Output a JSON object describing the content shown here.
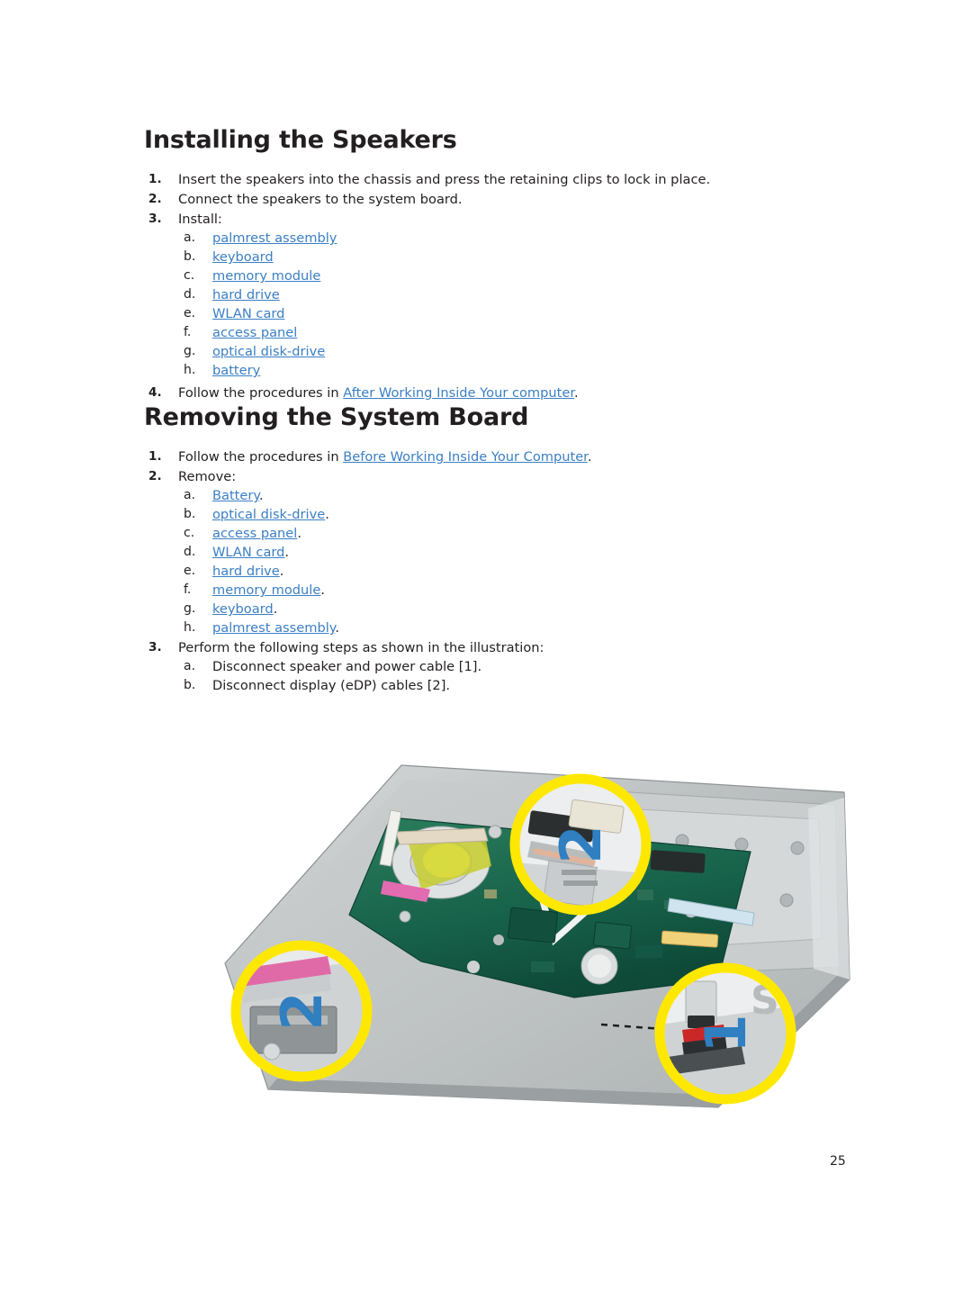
{
  "document": {
    "page_number": "25",
    "sections": [
      {
        "id": "installing-speakers",
        "title": "Installing the Speakers",
        "steps": [
          {
            "num": "1.",
            "text": "Insert the speakers into the chassis and press the retaining clips to lock in place."
          },
          {
            "num": "2.",
            "text": "Connect the speakers to the system board."
          },
          {
            "num": "3.",
            "text": "Install:",
            "sub": [
              {
                "num": "a.",
                "link": "palmrest assembly",
                "tail": ""
              },
              {
                "num": "b.",
                "link": "keyboard",
                "tail": ""
              },
              {
                "num": "c.",
                "link": "memory module",
                "tail": ""
              },
              {
                "num": "d.",
                "link": "hard drive",
                "tail": ""
              },
              {
                "num": "e.",
                "link": "WLAN card",
                "tail": ""
              },
              {
                "num": "f.",
                "link": "access panel",
                "tail": ""
              },
              {
                "num": "g.",
                "link": "optical disk-drive",
                "tail": ""
              },
              {
                "num": "h.",
                "link": "battery",
                "tail": ""
              }
            ]
          },
          {
            "num": "4.",
            "lead": "Follow the procedures in ",
            "link": "After Working Inside Your computer",
            "tail": "."
          }
        ]
      },
      {
        "id": "removing-system-board",
        "title": "Removing the System Board",
        "steps": [
          {
            "num": "1.",
            "lead": "Follow the procedures in ",
            "link": "Before Working Inside Your Computer",
            "tail": "."
          },
          {
            "num": "2.",
            "text": "Remove:",
            "sub": [
              {
                "num": "a.",
                "link": "Battery",
                "tail": "."
              },
              {
                "num": "b.",
                "link": "optical disk-drive",
                "tail": "."
              },
              {
                "num": "c.",
                "link": "access panel",
                "tail": "."
              },
              {
                "num": "d.",
                "link": "WLAN card",
                "tail": "."
              },
              {
                "num": "e.",
                "link": "hard drive",
                "tail": "."
              },
              {
                "num": "f.",
                "link": "memory module",
                "tail": "."
              },
              {
                "num": "g.",
                "link": "keyboard",
                "tail": "."
              },
              {
                "num": "h.",
                "link": "palmrest assembly",
                "tail": "."
              }
            ]
          },
          {
            "num": "3.",
            "text": "Perform the following steps as shown in the illustration:",
            "sub": [
              {
                "num": "a.",
                "plain": "Disconnect speaker and power cable [1]."
              },
              {
                "num": "b.",
                "plain": "Disconnect display (eDP) cables [2]."
              }
            ]
          }
        ]
      }
    ],
    "figure": {
      "alt": "Laptop system board with callouts",
      "callouts": [
        {
          "label": "2",
          "position": "top-right"
        },
        {
          "label": "2",
          "position": "bottom-left"
        },
        {
          "label": "1",
          "position": "bottom-right"
        }
      ],
      "colors": {
        "callout_ring": "#ffe800",
        "callout_digit": "#2f7fc1",
        "board_green": "#1d6b4f",
        "chassis_gray": "#b9bdbe"
      },
      "silkscreen_text": "SP"
    }
  }
}
